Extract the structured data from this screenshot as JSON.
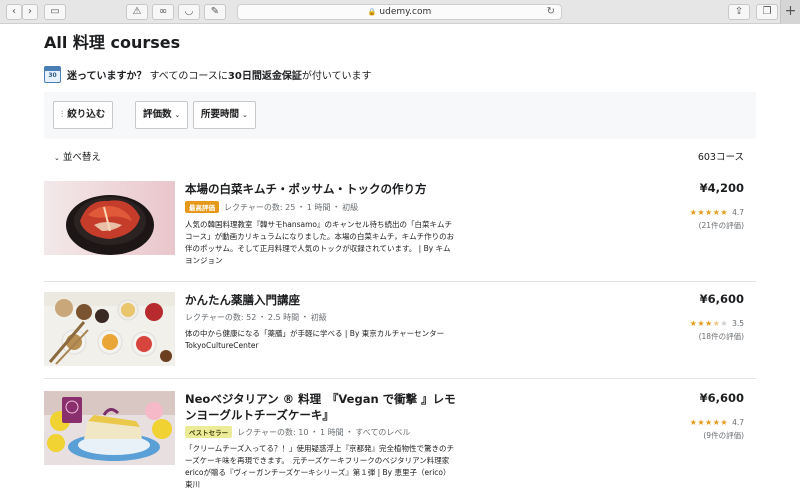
{
  "browser": {
    "url": "udemy.com"
  },
  "page": {
    "title": "All 料理 courses",
    "guarantee_question": "迷っていますか？",
    "guarantee_text": "すべてのコースに",
    "guarantee_bold": "30日間返金保証",
    "guarantee_tail": "が付いています",
    "calendar_number": "30"
  },
  "filters": {
    "filter_label": "絞り込む",
    "rating_label": "評価数",
    "duration_label": "所要時間"
  },
  "sort": {
    "label": "並べ替え",
    "count": "603コース"
  },
  "courses": [
    {
      "title": "本場の白菜キムチ・ポッサム・トックの作り方",
      "badge": "最高評価",
      "lectures": "レクチャーの数: 25",
      "duration": "1 時間",
      "level": "初級",
      "description": "人気の韓国料理教室『韓サモhansamo』のキャンセル待ち続出の「白菜キムチコース」が動画カリキュラムになりました。本場の白菜キムチ，キムチ作りのお伴のポッサム。そして正月料理で人気のトックが収録されています。 | By キム ヨンジョン",
      "price": "¥4,200",
      "rating": "4.7",
      "rating_value": 4.7,
      "reviews": "(21件の評価)"
    },
    {
      "title": "かんたん薬膳入門講座",
      "badge": "",
      "lectures": "レクチャーの数: 52",
      "duration": "2.5 時間",
      "level": "初級",
      "description": "体の中から健康になる「薬膳」が手軽に学べる | By 東京カルチャーセンター TokyoCultureCenter",
      "price": "¥6,600",
      "rating": "3.5",
      "rating_value": 3.5,
      "reviews": "(18件の評価)"
    },
    {
      "title": "Neoベジタリアン ® 料理　『Vegan で衝撃 』レモンヨーグルトチーズケーキ』",
      "badge": "ベストセラー",
      "lectures": "レクチャーの数: 10",
      "duration": "1 時間",
      "level": "すべてのレベル",
      "description": "「クリームチーズ入ってる？！」使用疑惑浮上『京都発』完全植物性で驚きのチーズケーキ味を再現できます。　元チーズケーキフリークのベジタリアン料理家ericoが贈る『ヴィーガンチーズケーキシリーズ』第１弾 | By 恵里子（erico） 東川",
      "price": "¥6,600",
      "rating": "4.7",
      "rating_value": 4.7,
      "reviews": "(9件の評価)"
    }
  ],
  "colors": {
    "star": "#e59819",
    "badge_top": "#e59819",
    "badge_best": "#eceb98",
    "filter_bg": "#f7f8fa"
  }
}
